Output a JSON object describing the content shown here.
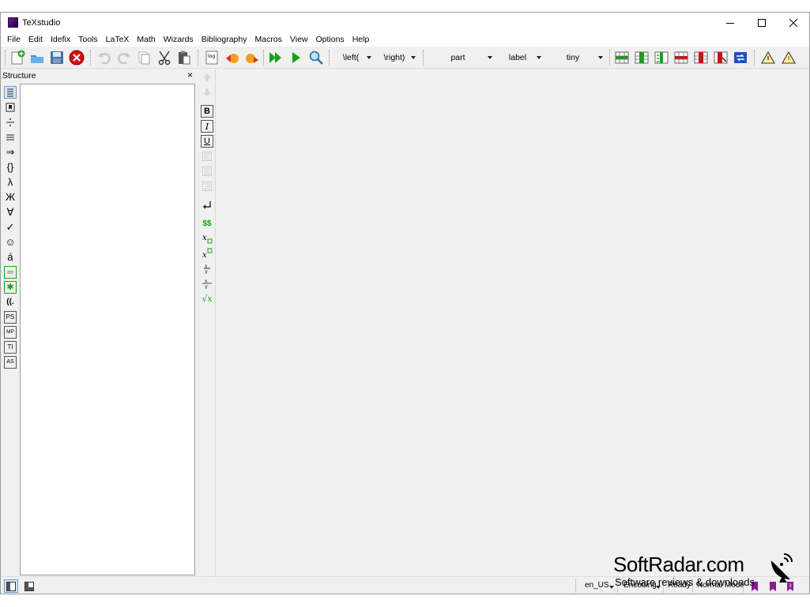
{
  "window": {
    "title": "TeXstudio"
  },
  "menu": [
    "File",
    "Edit",
    "Idefix",
    "Tools",
    "LaTeX",
    "Math",
    "Wizards",
    "Bibliography",
    "Macros",
    "View",
    "Options",
    "Help"
  ],
  "toolbar": {
    "log_label": "log",
    "combos": [
      {
        "value": "\\left("
      },
      {
        "value": "\\right)"
      },
      {
        "value": "part"
      },
      {
        "value": "label"
      },
      {
        "value": "tiny"
      }
    ]
  },
  "structure": {
    "title": "Structure",
    "close": "×"
  },
  "side_icon_glyphs": {
    "arrow": "⇒",
    "braces": "{}",
    "lambda": "λ",
    "cyrillic": "Ж",
    "forall": "∀",
    "check": "✓",
    "smiley": "☺",
    "accent": "á",
    "infinity": "∞",
    "asterisk": "✱",
    "bracket": "((.",
    "ps": "PS",
    "mp": "MP",
    "ti": "TI",
    "as": "AS"
  },
  "format": {
    "bold": "B",
    "italic": "I",
    "underline": "U",
    "dollar": "$$",
    "sqrt": "√x"
  },
  "status": {
    "language": "en_US",
    "encoding": "Encoding",
    "ready": "Ready",
    "mode": "Normal Mode"
  },
  "watermark": {
    "title": "SoftRadar.com",
    "subtitle": "Software reviews & downloads"
  },
  "colors": {
    "accent_green": "#1aa01a",
    "accent_red": "#d01010",
    "purple": "#8a1a9a"
  }
}
